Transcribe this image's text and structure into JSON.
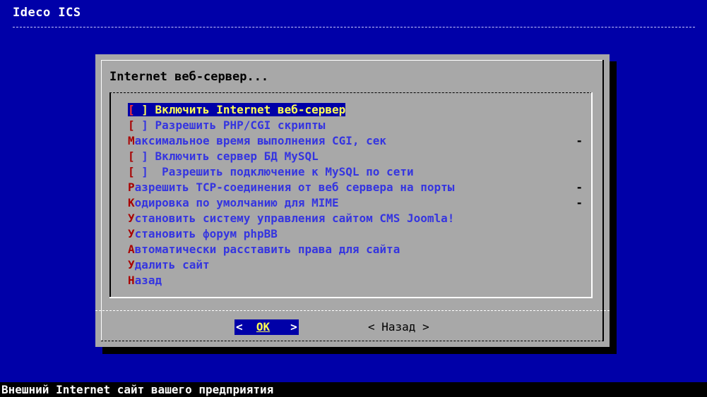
{
  "app": {
    "title": "Ideco ICS"
  },
  "dialog": {
    "title": "Internet веб-сервер...",
    "menu_items": [
      {
        "hot": "[",
        "rest": " ] Включить Internet веб-сервер",
        "trailing": "",
        "selected": true
      },
      {
        "hot": "[",
        "rest": " ] Разрешить PHP/CGI скрипты",
        "trailing": "",
        "selected": false
      },
      {
        "hot": "М",
        "rest": "аксимальное время выполнения CGI, сек",
        "trailing": "-",
        "selected": false
      },
      {
        "hot": "[",
        "rest": " ] Включить сервер БД MySQL",
        "trailing": "",
        "selected": false
      },
      {
        "hot": "[",
        "rest": " ]  Разрешить подключение к MySQL по сети",
        "trailing": "",
        "selected": false
      },
      {
        "hot": "Р",
        "rest": "азрешить TCP-соединения от веб сервера на порты",
        "trailing": "-",
        "selected": false
      },
      {
        "hot": "К",
        "rest": "одировка по умолчанию для MIME",
        "trailing": "-",
        "selected": false
      },
      {
        "hot": "У",
        "rest": "становить систему управления сайтом CMS Joomla!",
        "trailing": "",
        "selected": false
      },
      {
        "hot": "У",
        "rest": "становить форум phpBB",
        "trailing": "",
        "selected": false
      },
      {
        "hot": "А",
        "rest": "втоматически расставить права для сайта",
        "trailing": "",
        "selected": false
      },
      {
        "hot": "У",
        "rest": "далить сайт",
        "trailing": "",
        "selected": false
      },
      {
        "hot": "Н",
        "rest": "азад",
        "trailing": "",
        "selected": false
      }
    ],
    "buttons": {
      "ok_prefix": "<  ",
      "ok_label": "OK",
      "ok_suffix": "   >",
      "back_label": "< Назад >"
    }
  },
  "status_bar": {
    "text": "Внешний Internet сайт вашего предприятия"
  },
  "colors": {
    "background": "#0000a8",
    "dialog": "#a8a8a8",
    "item_text": "#3535e0",
    "hotkey": "#a80000",
    "selected_text": "#ffff55"
  }
}
